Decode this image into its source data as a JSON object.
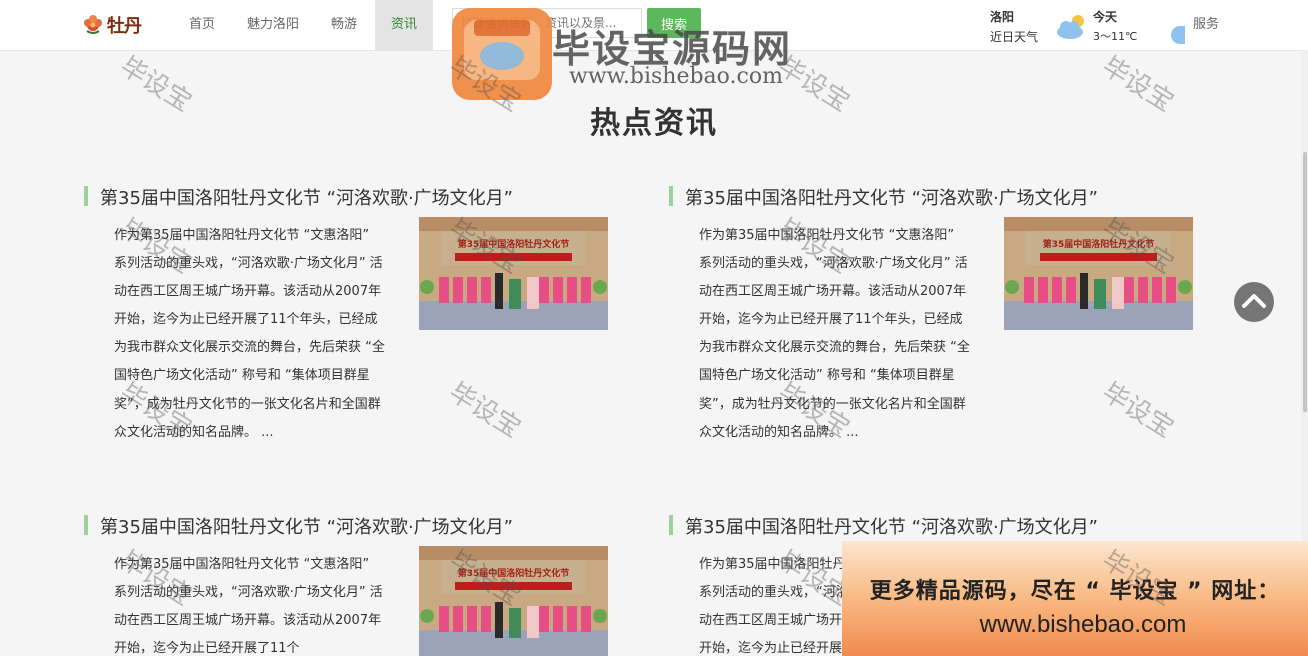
{
  "nav": {
    "logo_text": "牡丹",
    "items": [
      {
        "label": "首页"
      },
      {
        "label": "魅力洛阳"
      },
      {
        "label": "畅游"
      },
      {
        "label": "资讯"
      }
    ],
    "search_placeholder": "快速查询景区、资讯以及景...",
    "search_button": "搜索",
    "service": "服务"
  },
  "weather": {
    "city": "洛阳",
    "subtitle": "近日天气",
    "today_label": "今天",
    "temp": "3～11℃",
    "icon": "partly-cloudy-icon"
  },
  "section": {
    "title": "热点资讯"
  },
  "articles": [
    {
      "title": "第35届中国洛阳牡丹文化节 “河洛欢歌·广场文化月”",
      "body": "作为第35届中国洛阳牡丹文化节 “文惠洛阳” 系列活动的重头戏，“河洛欢歌·广场文化月” 活动在西工区周王城广场开幕。该活动从2007年开始，迄今为止已经开展了11个年头，已经成为我市群众文化展示交流的舞台，先后荣获 “全国特色广场文化活动” 称号和 “集体项目群星奖”，成为牡丹文化节的一张文化名片和全国群众文化活动的知名品牌。 ...",
      "image_banner": "第35届中国洛阳牡丹文化节"
    },
    {
      "title": "第35届中国洛阳牡丹文化节 “河洛欢歌·广场文化月”",
      "body": "作为第35届中国洛阳牡丹文化节 “文惠洛阳” 系列活动的重头戏，“河洛欢歌·广场文化月” 活动在西工区周王城广场开幕。该活动从2007年开始，迄今为止已经开展了11个年头，已经成为我市群众文化展示交流的舞台，先后荣获 “全国特色广场文化活动” 称号和 “集体项目群星奖”，成为牡丹文化节的一张文化名片和全国群众文化活动的知名品牌。 ...",
      "image_banner": "第35届中国洛阳牡丹文化节"
    },
    {
      "title": "第35届中国洛阳牡丹文化节 “河洛欢歌·广场文化月”",
      "body": "作为第35届中国洛阳牡丹文化节 “文惠洛阳” 系列活动的重头戏，“河洛欢歌·广场文化月” 活动在西工区周王城广场开幕。该活动从2007年开始，迄今为止已经开展了11个",
      "image_banner": "第35届中国洛阳牡丹文化节"
    },
    {
      "title": "第35届中国洛阳牡丹文化节 “河洛欢歌·广场文化月”",
      "body": "作为第35届中国洛阳牡丹文化节 “文惠洛阳” 系列活动的重头戏，“河洛欢歌·广场文化月” 活动在西工区周王城广场开幕。该活动从2007年开始，迄今为止已经开展了11个",
      "image_banner": "第35届中国洛阳牡丹文化节"
    }
  ],
  "watermark": {
    "site_name": "毕设宝源码网",
    "url": "www.bishebao.com",
    "tile_text": "毕设宝",
    "promo_line1": "更多精品源码，尽在 “ 毕设宝 ” 网址：",
    "promo_line2": "www.bishebao.com"
  },
  "colors": {
    "accent_green": "#5cb85c",
    "title_bar": "#9ed09e",
    "active_nav_bg": "#e4e4e4"
  }
}
